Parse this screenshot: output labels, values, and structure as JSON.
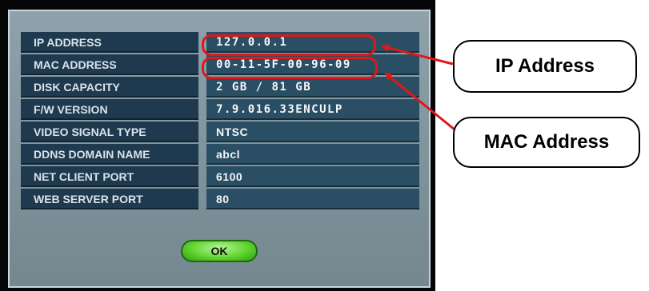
{
  "dialog": {
    "rows": [
      {
        "label": "IP ADDRESS",
        "value": "127.0.0.1"
      },
      {
        "label": "MAC ADDRESS",
        "value": "00-11-5F-00-96-09"
      },
      {
        "label": "DISK CAPACITY",
        "value": "2 GB / 81 GB"
      },
      {
        "label": "F/W VERSION",
        "value": "7.9.016.33ENCULP"
      },
      {
        "label": "VIDEO SIGNAL TYPE",
        "value": "NTSC"
      },
      {
        "label": "DDNS DOMAIN NAME",
        "value": "abcl"
      },
      {
        "label": "NET CLIENT PORT",
        "value": "6100"
      },
      {
        "label": "WEB SERVER PORT",
        "value": "80"
      }
    ],
    "ok_label": "OK"
  },
  "annotations": {
    "ip_callout": "IP Address",
    "mac_callout": "MAC Address"
  },
  "colors": {
    "annotation": "#e01818",
    "label_bg": "#1f3a4e",
    "value_bg": "#2a4e63",
    "ok_button": "#5fd42f"
  }
}
